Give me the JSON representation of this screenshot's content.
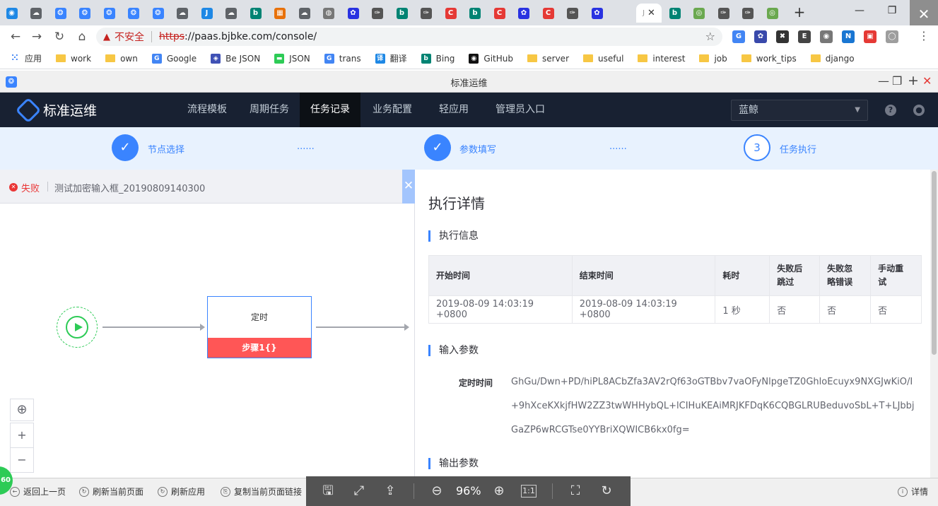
{
  "browser": {
    "tabs": [
      {
        "icon": "cloud-icon",
        "color": "#1e88e5",
        "glyph": "◉"
      },
      {
        "icon": "cloud-icon",
        "color": "#5f6368",
        "glyph": "☁"
      },
      {
        "icon": "bk-icon",
        "color": "#3a84ff",
        "glyph": "❂"
      },
      {
        "icon": "bk-icon",
        "color": "#3a84ff",
        "glyph": "❂"
      },
      {
        "icon": "bk-icon",
        "color": "#3a84ff",
        "glyph": "❂"
      },
      {
        "icon": "bk-icon",
        "color": "#3a84ff",
        "glyph": "❂"
      },
      {
        "icon": "bk-icon",
        "color": "#3a84ff",
        "glyph": "❂"
      },
      {
        "icon": "cloud-icon",
        "color": "#5f6368",
        "glyph": "☁"
      },
      {
        "icon": "j-icon",
        "color": "#1e88e5",
        "glyph": "J"
      },
      {
        "icon": "cloud-icon",
        "color": "#5f6368",
        "glyph": "☁"
      },
      {
        "icon": "bing-icon",
        "color": "#008373",
        "glyph": "b"
      },
      {
        "icon": "grid-icon",
        "color": "#e8710a",
        "glyph": "▦"
      },
      {
        "icon": "cloud-icon",
        "color": "#5f6368",
        "glyph": "☁"
      },
      {
        "icon": "globe-icon",
        "color": "#777777",
        "glyph": "◍"
      },
      {
        "icon": "baidu-icon",
        "color": "#2932e1",
        "glyph": "✿"
      },
      {
        "icon": "pen-icon",
        "color": "#555555",
        "glyph": "✑"
      },
      {
        "icon": "bing-icon",
        "color": "#008373",
        "glyph": "b"
      },
      {
        "icon": "pen-icon",
        "color": "#555555",
        "glyph": "✑"
      },
      {
        "icon": "csdn-icon",
        "color": "#e53935",
        "glyph": "C"
      },
      {
        "icon": "bing-icon",
        "color": "#008373",
        "glyph": "b"
      },
      {
        "icon": "csdn-icon",
        "color": "#e53935",
        "glyph": "C"
      },
      {
        "icon": "baidu-icon",
        "color": "#2932e1",
        "glyph": "✿"
      },
      {
        "icon": "csdn-icon",
        "color": "#e53935",
        "glyph": "C"
      },
      {
        "icon": "pen-icon",
        "color": "#555555",
        "glyph": "✑"
      },
      {
        "icon": "baidu-icon",
        "color": "#2932e1",
        "glyph": "✿"
      }
    ],
    "active_tab_label": "J",
    "close_glyph": "✕",
    "tabs_after": [
      {
        "icon": "bing-icon",
        "color": "#008373",
        "glyph": "b"
      },
      {
        "icon": "eye-icon",
        "color": "#6aa84f",
        "glyph": "◎"
      },
      {
        "icon": "pen-icon",
        "color": "#555555",
        "glyph": "✑"
      },
      {
        "icon": "pen-icon",
        "color": "#555555",
        "glyph": "✑"
      },
      {
        "icon": "eye-icon",
        "color": "#6aa84f",
        "glyph": "◎"
      }
    ],
    "new_tab": "+",
    "minimize": "—",
    "maximize": "❐",
    "close": "✕",
    "back": "←",
    "forward": "→",
    "reload": "↻",
    "home": "⌂",
    "insecure_label": "不安全",
    "url_scheme": "https",
    "url_rest": "://paas.bjbke.com/console/",
    "star": "☆",
    "extensions": [
      {
        "color": "#4285f4",
        "glyph": "G"
      },
      {
        "color": "#3949ab",
        "glyph": "✿"
      },
      {
        "color": "#333333",
        "glyph": "✖"
      },
      {
        "color": "#444444",
        "glyph": "E"
      },
      {
        "color": "#777777",
        "glyph": "◉"
      },
      {
        "color": "#1976d2",
        "glyph": "N"
      },
      {
        "color": "#e53935",
        "glyph": "▣"
      },
      {
        "color": "#9e9e9e",
        "glyph": "◯"
      }
    ],
    "menu": "⋮",
    "bookmarks": [
      {
        "label": "应用",
        "type": "apps"
      },
      {
        "label": "work",
        "type": "folder"
      },
      {
        "label": "own",
        "type": "folder"
      },
      {
        "label": "Google",
        "type": "icon",
        "color": "#4285f4",
        "glyph": "G"
      },
      {
        "label": "Be JSON",
        "type": "icon",
        "color": "#3f51b5",
        "glyph": "◈"
      },
      {
        "label": "JSON",
        "type": "icon",
        "color": "#2dcb56",
        "glyph": "▬"
      },
      {
        "label": "trans",
        "type": "icon",
        "color": "#4285f4",
        "glyph": "G"
      },
      {
        "label": "翻译",
        "type": "icon",
        "color": "#1e88e5",
        "glyph": "译"
      },
      {
        "label": "Bing",
        "type": "icon",
        "color": "#008373",
        "glyph": "b"
      },
      {
        "label": "GitHub",
        "type": "icon",
        "color": "#111111",
        "glyph": "◉"
      },
      {
        "label": "server",
        "type": "folder"
      },
      {
        "label": "useful",
        "type": "folder"
      },
      {
        "label": "interest",
        "type": "folder"
      },
      {
        "label": "job",
        "type": "folder"
      },
      {
        "label": "work_tips",
        "type": "folder"
      },
      {
        "label": "django",
        "type": "folder"
      }
    ]
  },
  "app": {
    "window_title": "标准运维",
    "title_controls": [
      "—",
      "❐",
      "+",
      "✕"
    ],
    "logo_text": "标准运维",
    "nav": [
      "流程模板",
      "周期任务",
      "任务记录",
      "业务配置",
      "轻应用",
      "管理员入口"
    ],
    "active_nav": "任务记录",
    "business": "蓝鲸",
    "business_caret": "▼",
    "help_glyph": "?",
    "user_glyph": "●",
    "steps": [
      {
        "label": "节点选择",
        "glyph": "✓"
      },
      {
        "label": "参数填写",
        "glyph": "✓"
      },
      {
        "label": "任务执行",
        "glyph": "3"
      }
    ],
    "step_dots": "......",
    "task": {
      "status": "失败",
      "status_glyph": "✕",
      "name": "测试加密输入框_20190809140300",
      "toggle_glyph": "✕"
    },
    "canvas": {
      "node_title": "定时",
      "node_step": "步骤1{}",
      "locate_glyph": "⊕",
      "zoom_in": "+",
      "zoom_out": "−"
    },
    "detail": {
      "title": "执行详情",
      "exec_info_title": "执行信息",
      "columns": [
        "开始时间",
        "结束时间",
        "耗时",
        "失败后跳过",
        "失败忽略错误",
        "手动重试"
      ],
      "columns_display": [
        "开始时间",
        "结束时间",
        "耗时",
        "失败后\n跳过",
        "失败忽\n略错误",
        "手动重\n试"
      ],
      "row": [
        "2019-08-09 14:03:19 +0800",
        "2019-08-09 14:03:19 +0800",
        "1 秒",
        "否",
        "否",
        "否"
      ],
      "input_title": "输入参数",
      "param_key": "定时时间",
      "param_value": "GhGu/Dwn+PD/hiPL8ACbZfa3AV2rQf63oGTBbv7vaOFyNlpgeTZ0GhloEcuyx9NXGJwKiO/I+9hXceKXkjfHW2ZZ3twWHHybQL+lCIHuKEAiMRJKFDqK6CQBGLRUBeduvoSbL+T+LJbbjGaZP6wRCGTse0YYBriXQWICB6kx0fg=",
      "output_title": "输出参数"
    },
    "bottom": [
      {
        "label": "返回上一页",
        "glyph": "←"
      },
      {
        "label": "刷新当前页面",
        "glyph": "↻"
      },
      {
        "label": "刷新应用",
        "glyph": "↻"
      },
      {
        "label": "复制当前页面链接",
        "glyph": "⎘"
      }
    ],
    "details_label": "详情",
    "details_glyph": "i",
    "badge": "60"
  },
  "viewer": {
    "zoom": "96%",
    "icons": [
      "save-icon",
      "crop-icon",
      "share-icon",
      "zoom-out-icon",
      "zoom-in-icon",
      "actual-size-icon",
      "fit-icon",
      "rotate-icon"
    ],
    "glyphs": [
      "🖫",
      "⤢",
      "⇪",
      "⊖",
      "⊕",
      "1:1",
      "⛶",
      "↻"
    ]
  }
}
